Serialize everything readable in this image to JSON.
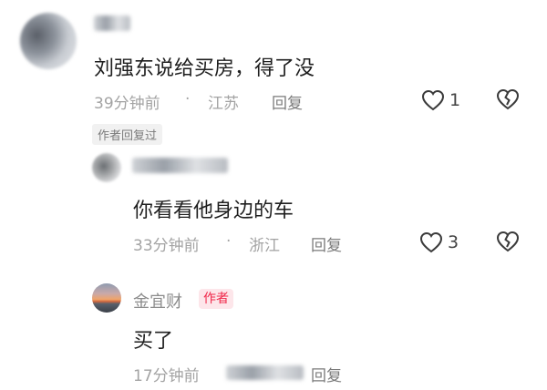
{
  "comments": [
    {
      "text": "刘强东说给买房，得了没",
      "time": "39分钟前",
      "dot": "·",
      "location": "江苏",
      "reply_label": "回复",
      "likes": "1",
      "author_replied": "作者回复过"
    },
    {
      "text": "你看看他身边的车",
      "time": "33分钟前",
      "dot": "·",
      "location": "浙江",
      "reply_label": "回复",
      "likes": "3"
    },
    {
      "username": "金宜财",
      "author_tag": "作者",
      "text": "买了",
      "time": "17分钟前",
      "reply_label": "回复"
    }
  ],
  "icons": {
    "like": "heart-outline-icon",
    "dislike": "broken-heart-icon"
  }
}
